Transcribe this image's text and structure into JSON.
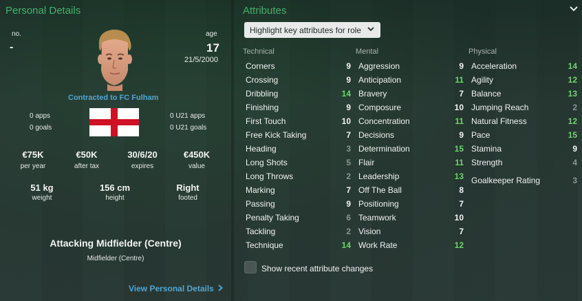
{
  "personal": {
    "title": "Personal Details",
    "no_label": "no.",
    "no_value": "-",
    "age_label": "age",
    "age_value": "17",
    "dob": "21/5/2000",
    "contract": "Contracted to FC Fulham",
    "apps": "0 apps",
    "goals": "0 goals",
    "u21_apps": "0 U21 apps",
    "u21_goals": "0 U21 goals",
    "flag_icon": "england-flag-icon",
    "wage_value": "€75K",
    "wage_label": "per year",
    "after_tax_value": "€50K",
    "after_tax_label": "after tax",
    "expires_value": "30/6/20",
    "expires_label": "expires",
    "value_value": "€450K",
    "value_label": "value",
    "weight_value": "51 kg",
    "weight_label": "weight",
    "height_value": "156 cm",
    "height_label": "height",
    "foot_value": "Right",
    "foot_label": "footed",
    "position": "Attacking Midfielder (Centre)",
    "position_sub": "Midfielder (Centre)",
    "view_link": "View Personal Details"
  },
  "attributes": {
    "title": "Attributes",
    "highlight_select": "Highlight key attributes for role",
    "technical_label": "Technical",
    "mental_label": "Mental",
    "physical_label": "Physical",
    "technical": [
      {
        "name": "Corners",
        "value": "9"
      },
      {
        "name": "Crossing",
        "value": "9"
      },
      {
        "name": "Dribbling",
        "value": "14"
      },
      {
        "name": "Finishing",
        "value": "9"
      },
      {
        "name": "First Touch",
        "value": "10"
      },
      {
        "name": "Free Kick Taking",
        "value": "7"
      },
      {
        "name": "Heading",
        "value": "3"
      },
      {
        "name": "Long Shots",
        "value": "5"
      },
      {
        "name": "Long Throws",
        "value": "2"
      },
      {
        "name": "Marking",
        "value": "7"
      },
      {
        "name": "Passing",
        "value": "9"
      },
      {
        "name": "Penalty Taking",
        "value": "6"
      },
      {
        "name": "Tackling",
        "value": "2"
      },
      {
        "name": "Technique",
        "value": "14"
      }
    ],
    "mental": [
      {
        "name": "Aggression",
        "value": "9"
      },
      {
        "name": "Anticipation",
        "value": "11"
      },
      {
        "name": "Bravery",
        "value": "7"
      },
      {
        "name": "Composure",
        "value": "10"
      },
      {
        "name": "Concentration",
        "value": "11"
      },
      {
        "name": "Decisions",
        "value": "9"
      },
      {
        "name": "Determination",
        "value": "15"
      },
      {
        "name": "Flair",
        "value": "11"
      },
      {
        "name": "Leadership",
        "value": "13"
      },
      {
        "name": "Off The Ball",
        "value": "8"
      },
      {
        "name": "Positioning",
        "value": "7"
      },
      {
        "name": "Teamwork",
        "value": "10"
      },
      {
        "name": "Vision",
        "value": "7"
      },
      {
        "name": "Work Rate",
        "value": "12"
      }
    ],
    "physical": [
      {
        "name": "Acceleration",
        "value": "14"
      },
      {
        "name": "Agility",
        "value": "12"
      },
      {
        "name": "Balance",
        "value": "13"
      },
      {
        "name": "Jumping Reach",
        "value": "2"
      },
      {
        "name": "Natural Fitness",
        "value": "12"
      },
      {
        "name": "Pace",
        "value": "15"
      },
      {
        "name": "Stamina",
        "value": "9"
      },
      {
        "name": "Strength",
        "value": "4"
      }
    ],
    "goalkeeper_label": "Goalkeeper Rating",
    "goalkeeper_value": "3",
    "show_changes": "Show recent attribute changes"
  },
  "colors": {
    "title_green": "#46b06a",
    "link_blue": "#4fa6d6",
    "high_value_green": "#6cd66a",
    "low_value_grey": "#8a9692"
  }
}
